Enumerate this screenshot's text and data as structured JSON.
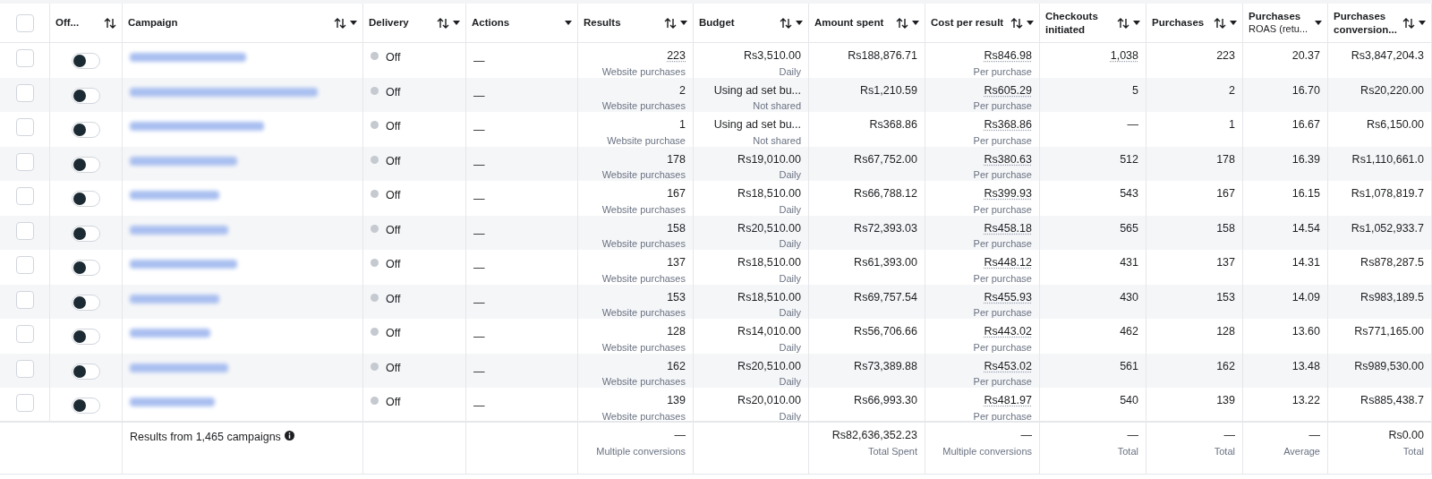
{
  "columns": [
    {
      "kind": "checkbox",
      "checked": false
    },
    {
      "label": "Off...",
      "sort": true,
      "menu": false
    },
    {
      "label": "Campaign",
      "sort": true,
      "menu": true
    },
    {
      "label": "Delivery",
      "sort": true,
      "menu": true
    },
    {
      "label": "Actions",
      "sort": false,
      "menu": true
    },
    {
      "label": "Results",
      "sort": true,
      "menu": true
    },
    {
      "label": "Budget",
      "sort": true,
      "menu": true
    },
    {
      "label": "Amount spent",
      "sort": true,
      "menu": true
    },
    {
      "label": "Cost per result",
      "sort": true,
      "menu": true
    },
    {
      "label": "Checkouts initiated",
      "sort": true,
      "menu": true
    },
    {
      "label": "Purchases",
      "sort": true,
      "menu": true
    },
    {
      "label": "Purchases",
      "sublabel": "ROAS (retu...",
      "sort": false,
      "menu": true
    },
    {
      "label": "Purchases conversion...",
      "sort": true,
      "menu": true
    }
  ],
  "rows": [
    {
      "checked": false,
      "on": false,
      "status": "Off",
      "actions": "—",
      "results": "223",
      "results_label": "Website purchases",
      "budget": "Rs3,510.00",
      "budget_label": "Daily",
      "amount_spent": "Rs188,876.71",
      "cost": "Rs846.98",
      "cost_label": "Per purchase",
      "checkouts": "1,038",
      "purchases": "223",
      "roas": "20.37",
      "conversion": "Rs3,847,204.3"
    },
    {
      "checked": false,
      "on": false,
      "status": "Off",
      "actions": "—",
      "results": "2",
      "results_label": "Website purchases",
      "budget": "Using ad set bu...",
      "budget_label": "Not shared",
      "amount_spent": "Rs1,210.59",
      "cost": "Rs605.29",
      "cost_label": "Per purchase",
      "checkouts": "5",
      "purchases": "2",
      "roas": "16.70",
      "conversion": "Rs20,220.00"
    },
    {
      "checked": false,
      "on": false,
      "status": "Off",
      "actions": "—",
      "results": "1",
      "results_label": "Website purchase",
      "budget": "Using ad set bu...",
      "budget_label": "Not shared",
      "amount_spent": "Rs368.86",
      "cost": "Rs368.86",
      "cost_label": "Per purchase",
      "checkouts": "—",
      "purchases": "1",
      "roas": "16.67",
      "conversion": "Rs6,150.00"
    },
    {
      "checked": false,
      "on": false,
      "status": "Off",
      "actions": "—",
      "results": "178",
      "results_label": "Website purchases",
      "budget": "Rs19,010.00",
      "budget_label": "Daily",
      "amount_spent": "Rs67,752.00",
      "cost": "Rs380.63",
      "cost_label": "Per purchase",
      "checkouts": "512",
      "purchases": "178",
      "roas": "16.39",
      "conversion": "Rs1,110,661.0"
    },
    {
      "checked": false,
      "on": false,
      "status": "Off",
      "actions": "—",
      "results": "167",
      "results_label": "Website purchases",
      "budget": "Rs18,510.00",
      "budget_label": "Daily",
      "amount_spent": "Rs66,788.12",
      "cost": "Rs399.93",
      "cost_label": "Per purchase",
      "checkouts": "543",
      "purchases": "167",
      "roas": "16.15",
      "conversion": "Rs1,078,819.7"
    },
    {
      "checked": false,
      "on": false,
      "status": "Off",
      "actions": "—",
      "results": "158",
      "results_label": "Website purchases",
      "budget": "Rs20,510.00",
      "budget_label": "Daily",
      "amount_spent": "Rs72,393.03",
      "cost": "Rs458.18",
      "cost_label": "Per purchase",
      "checkouts": "565",
      "purchases": "158",
      "roas": "14.54",
      "conversion": "Rs1,052,933.7"
    },
    {
      "checked": false,
      "on": false,
      "status": "Off",
      "actions": "—",
      "results": "137",
      "results_label": "Website purchases",
      "budget": "Rs18,510.00",
      "budget_label": "Daily",
      "amount_spent": "Rs61,393.00",
      "cost": "Rs448.12",
      "cost_label": "Per purchase",
      "checkouts": "431",
      "purchases": "137",
      "roas": "14.31",
      "conversion": "Rs878,287.5"
    },
    {
      "checked": false,
      "on": false,
      "status": "Off",
      "actions": "—",
      "results": "153",
      "results_label": "Website purchases",
      "budget": "Rs18,510.00",
      "budget_label": "Daily",
      "amount_spent": "Rs69,757.54",
      "cost": "Rs455.93",
      "cost_label": "Per purchase",
      "checkouts": "430",
      "purchases": "153",
      "roas": "14.09",
      "conversion": "Rs983,189.5"
    },
    {
      "checked": false,
      "on": false,
      "status": "Off",
      "actions": "—",
      "results": "128",
      "results_label": "Website purchases",
      "budget": "Rs14,010.00",
      "budget_label": "Daily",
      "amount_spent": "Rs56,706.66",
      "cost": "Rs443.02",
      "cost_label": "Per purchase",
      "checkouts": "462",
      "purchases": "128",
      "roas": "13.60",
      "conversion": "Rs771,165.00"
    },
    {
      "checked": false,
      "on": false,
      "status": "Off",
      "actions": "—",
      "results": "162",
      "results_label": "Website purchases",
      "budget": "Rs20,510.00",
      "budget_label": "Daily",
      "amount_spent": "Rs73,389.88",
      "cost": "Rs453.02",
      "cost_label": "Per purchase",
      "checkouts": "561",
      "purchases": "162",
      "roas": "13.48",
      "conversion": "Rs989,530.00"
    },
    {
      "checked": false,
      "on": false,
      "status": "Off",
      "actions": "—",
      "results": "139",
      "results_label": "Website purchases",
      "budget": "Rs20,010.00",
      "budget_label": "Daily",
      "amount_spent": "Rs66,993.30",
      "cost": "Rs481.97",
      "cost_label": "Per purchase",
      "checkouts": "540",
      "purchases": "139",
      "roas": "13.22",
      "conversion": "Rs885,438.7"
    }
  ],
  "footer": {
    "summary": "Results from 1,465 campaigns",
    "totals": [
      {
        "value": "—",
        "label": "Multiple conversions"
      },
      {
        "value": "Rs82,636,352.23",
        "label": "Total Spent"
      },
      {
        "value": "—",
        "label": "Multiple conversions"
      },
      {
        "value": "—",
        "label": "Total"
      },
      {
        "value": "—",
        "label": "Total"
      },
      {
        "value": "—",
        "label": "Average"
      },
      {
        "value": "Rs0.00",
        "label": "Total"
      }
    ]
  }
}
